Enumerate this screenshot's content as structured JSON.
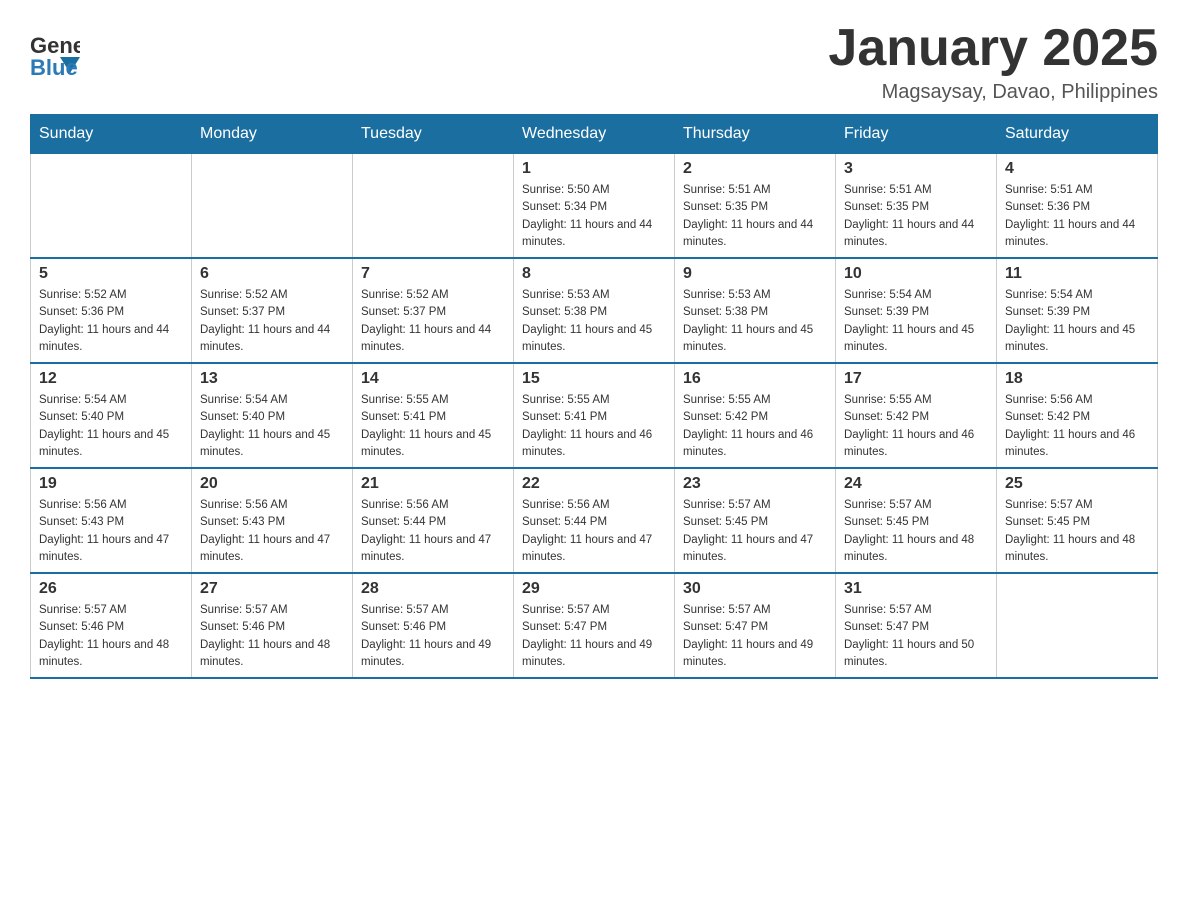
{
  "header": {
    "logo_general": "General",
    "logo_blue": "Blue",
    "month_title": "January 2025",
    "location": "Magsaysay, Davao, Philippines"
  },
  "days_of_week": [
    "Sunday",
    "Monday",
    "Tuesday",
    "Wednesday",
    "Thursday",
    "Friday",
    "Saturday"
  ],
  "weeks": [
    [
      {
        "day": "",
        "info": ""
      },
      {
        "day": "",
        "info": ""
      },
      {
        "day": "",
        "info": ""
      },
      {
        "day": "1",
        "info": "Sunrise: 5:50 AM\nSunset: 5:34 PM\nDaylight: 11 hours and 44 minutes."
      },
      {
        "day": "2",
        "info": "Sunrise: 5:51 AM\nSunset: 5:35 PM\nDaylight: 11 hours and 44 minutes."
      },
      {
        "day": "3",
        "info": "Sunrise: 5:51 AM\nSunset: 5:35 PM\nDaylight: 11 hours and 44 minutes."
      },
      {
        "day": "4",
        "info": "Sunrise: 5:51 AM\nSunset: 5:36 PM\nDaylight: 11 hours and 44 minutes."
      }
    ],
    [
      {
        "day": "5",
        "info": "Sunrise: 5:52 AM\nSunset: 5:36 PM\nDaylight: 11 hours and 44 minutes."
      },
      {
        "day": "6",
        "info": "Sunrise: 5:52 AM\nSunset: 5:37 PM\nDaylight: 11 hours and 44 minutes."
      },
      {
        "day": "7",
        "info": "Sunrise: 5:52 AM\nSunset: 5:37 PM\nDaylight: 11 hours and 44 minutes."
      },
      {
        "day": "8",
        "info": "Sunrise: 5:53 AM\nSunset: 5:38 PM\nDaylight: 11 hours and 45 minutes."
      },
      {
        "day": "9",
        "info": "Sunrise: 5:53 AM\nSunset: 5:38 PM\nDaylight: 11 hours and 45 minutes."
      },
      {
        "day": "10",
        "info": "Sunrise: 5:54 AM\nSunset: 5:39 PM\nDaylight: 11 hours and 45 minutes."
      },
      {
        "day": "11",
        "info": "Sunrise: 5:54 AM\nSunset: 5:39 PM\nDaylight: 11 hours and 45 minutes."
      }
    ],
    [
      {
        "day": "12",
        "info": "Sunrise: 5:54 AM\nSunset: 5:40 PM\nDaylight: 11 hours and 45 minutes."
      },
      {
        "day": "13",
        "info": "Sunrise: 5:54 AM\nSunset: 5:40 PM\nDaylight: 11 hours and 45 minutes."
      },
      {
        "day": "14",
        "info": "Sunrise: 5:55 AM\nSunset: 5:41 PM\nDaylight: 11 hours and 45 minutes."
      },
      {
        "day": "15",
        "info": "Sunrise: 5:55 AM\nSunset: 5:41 PM\nDaylight: 11 hours and 46 minutes."
      },
      {
        "day": "16",
        "info": "Sunrise: 5:55 AM\nSunset: 5:42 PM\nDaylight: 11 hours and 46 minutes."
      },
      {
        "day": "17",
        "info": "Sunrise: 5:55 AM\nSunset: 5:42 PM\nDaylight: 11 hours and 46 minutes."
      },
      {
        "day": "18",
        "info": "Sunrise: 5:56 AM\nSunset: 5:42 PM\nDaylight: 11 hours and 46 minutes."
      }
    ],
    [
      {
        "day": "19",
        "info": "Sunrise: 5:56 AM\nSunset: 5:43 PM\nDaylight: 11 hours and 47 minutes."
      },
      {
        "day": "20",
        "info": "Sunrise: 5:56 AM\nSunset: 5:43 PM\nDaylight: 11 hours and 47 minutes."
      },
      {
        "day": "21",
        "info": "Sunrise: 5:56 AM\nSunset: 5:44 PM\nDaylight: 11 hours and 47 minutes."
      },
      {
        "day": "22",
        "info": "Sunrise: 5:56 AM\nSunset: 5:44 PM\nDaylight: 11 hours and 47 minutes."
      },
      {
        "day": "23",
        "info": "Sunrise: 5:57 AM\nSunset: 5:45 PM\nDaylight: 11 hours and 47 minutes."
      },
      {
        "day": "24",
        "info": "Sunrise: 5:57 AM\nSunset: 5:45 PM\nDaylight: 11 hours and 48 minutes."
      },
      {
        "day": "25",
        "info": "Sunrise: 5:57 AM\nSunset: 5:45 PM\nDaylight: 11 hours and 48 minutes."
      }
    ],
    [
      {
        "day": "26",
        "info": "Sunrise: 5:57 AM\nSunset: 5:46 PM\nDaylight: 11 hours and 48 minutes."
      },
      {
        "day": "27",
        "info": "Sunrise: 5:57 AM\nSunset: 5:46 PM\nDaylight: 11 hours and 48 minutes."
      },
      {
        "day": "28",
        "info": "Sunrise: 5:57 AM\nSunset: 5:46 PM\nDaylight: 11 hours and 49 minutes."
      },
      {
        "day": "29",
        "info": "Sunrise: 5:57 AM\nSunset: 5:47 PM\nDaylight: 11 hours and 49 minutes."
      },
      {
        "day": "30",
        "info": "Sunrise: 5:57 AM\nSunset: 5:47 PM\nDaylight: 11 hours and 49 minutes."
      },
      {
        "day": "31",
        "info": "Sunrise: 5:57 AM\nSunset: 5:47 PM\nDaylight: 11 hours and 50 minutes."
      },
      {
        "day": "",
        "info": ""
      }
    ]
  ]
}
